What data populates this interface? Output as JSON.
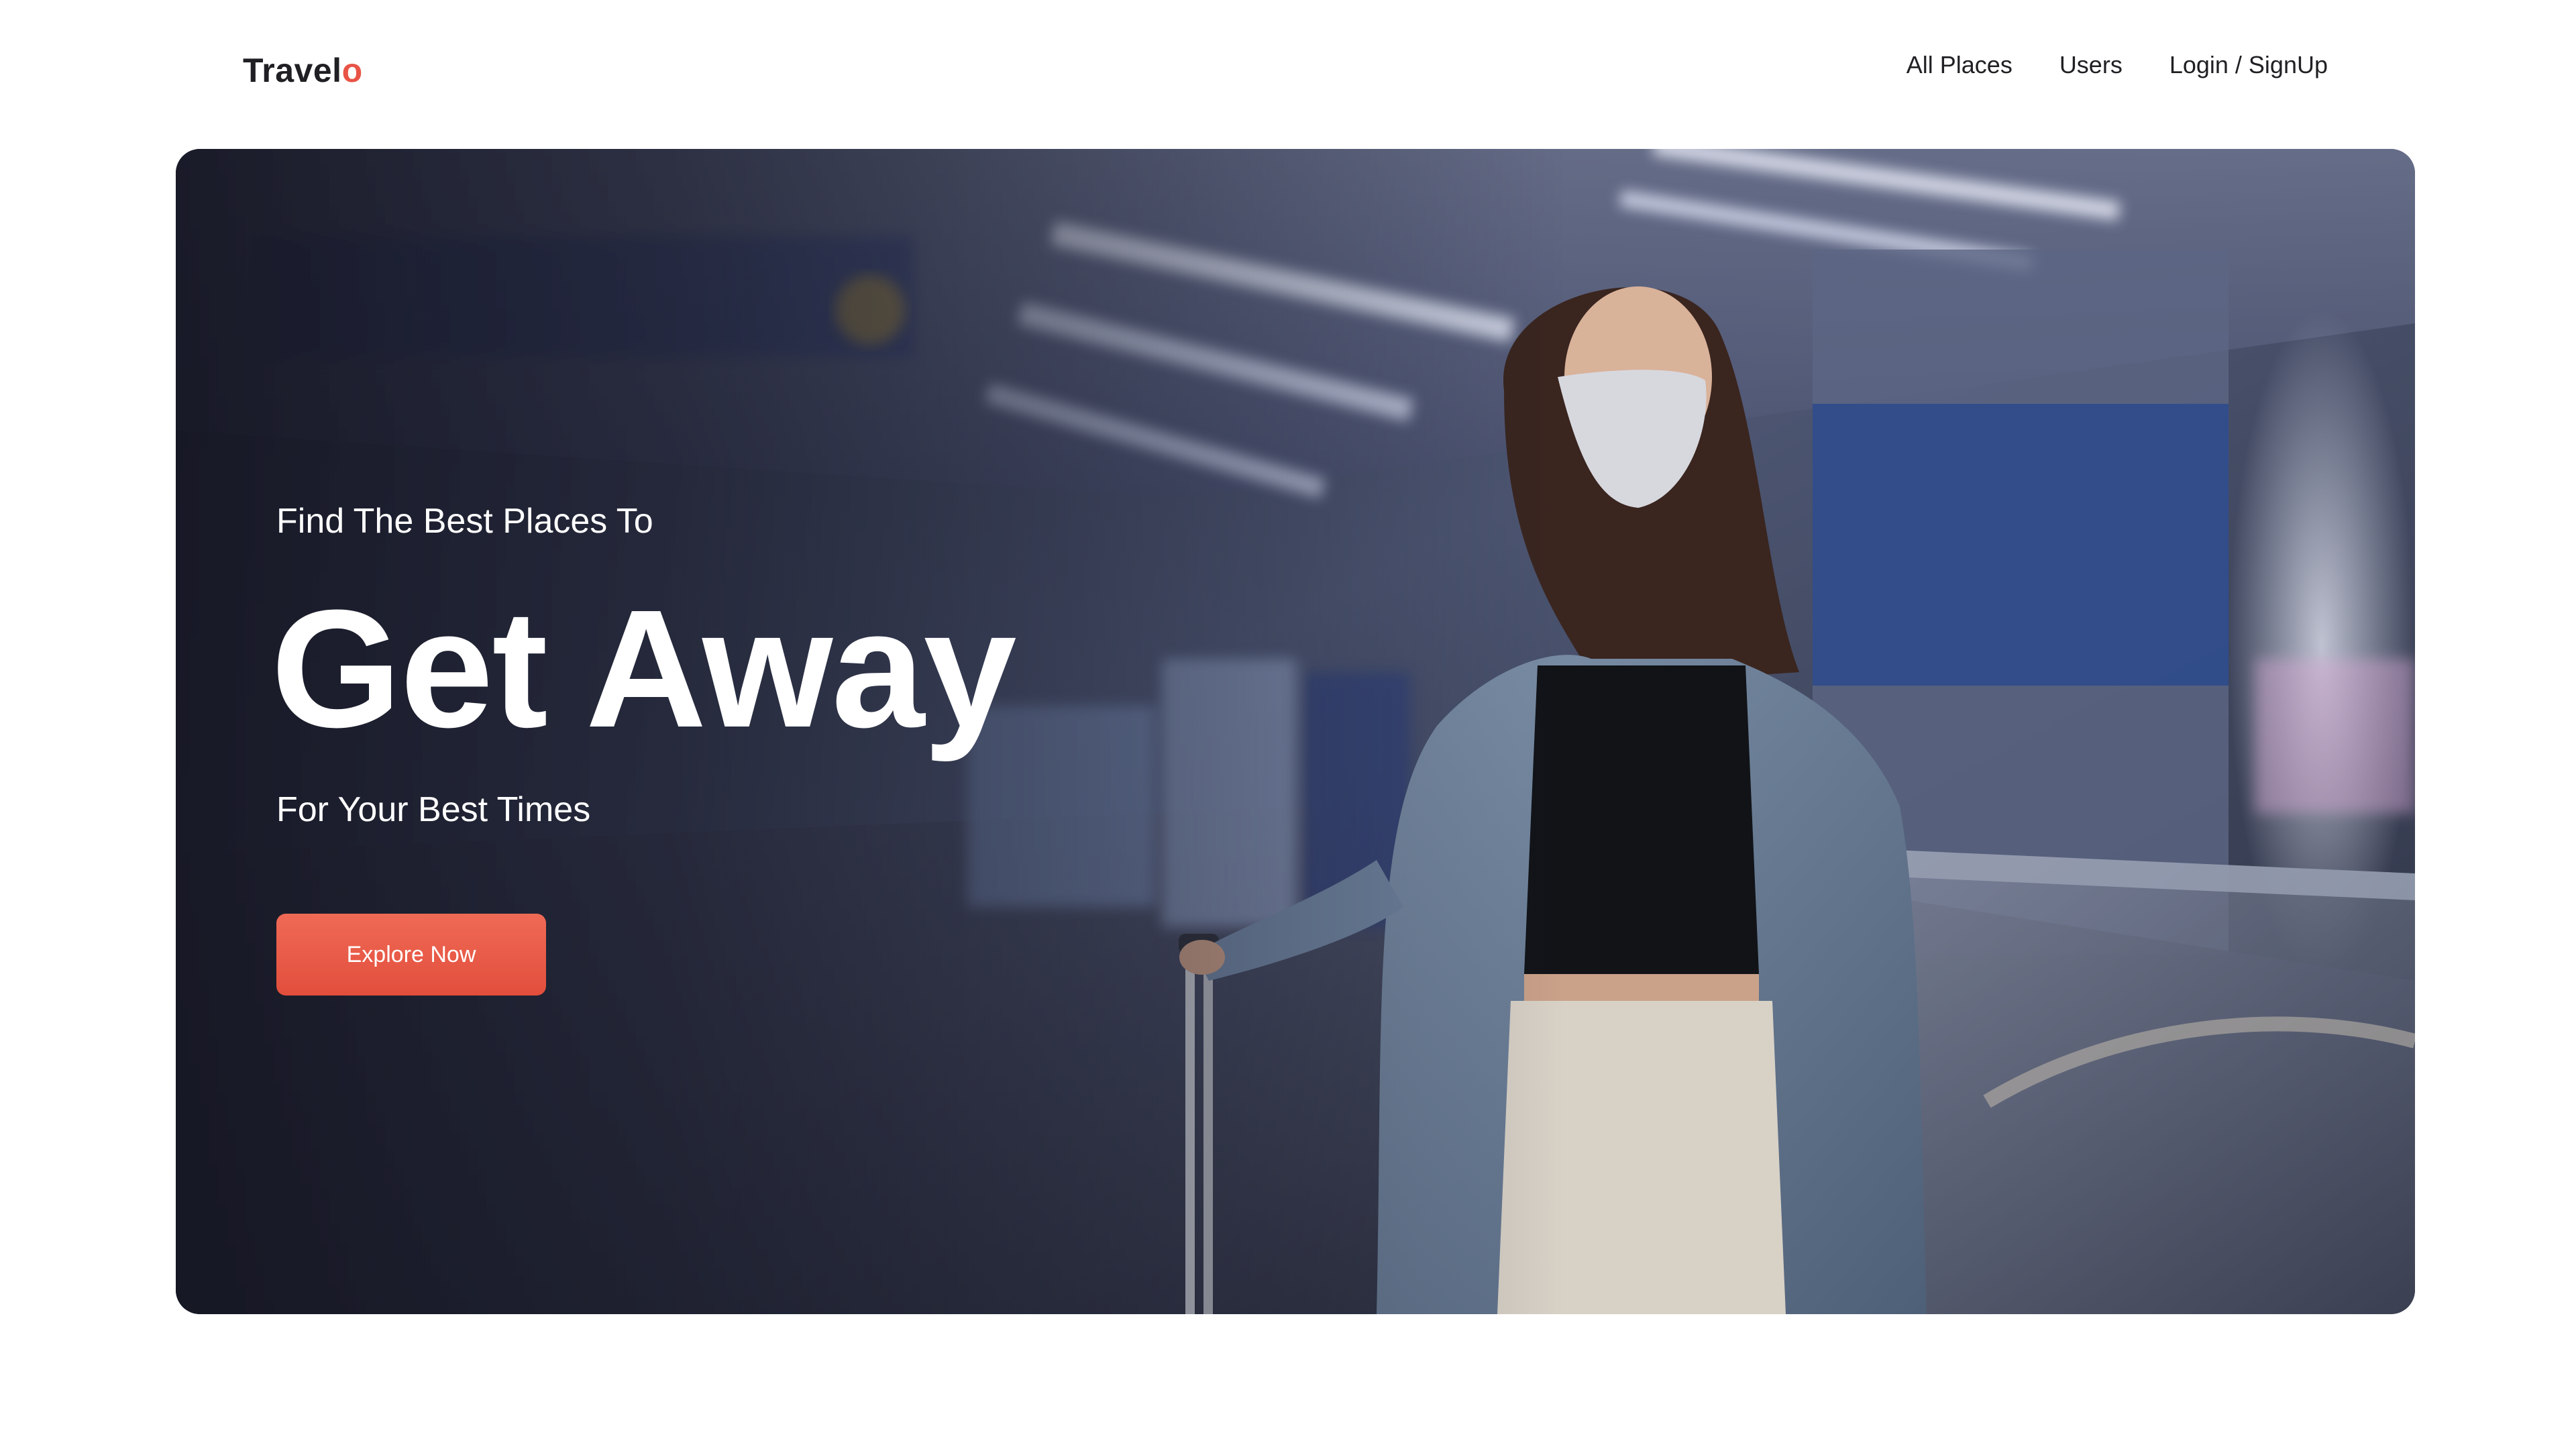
{
  "brand": {
    "name_main": "Travel",
    "name_accent": "o"
  },
  "nav": {
    "links": [
      {
        "label": "All Places"
      },
      {
        "label": "Users"
      },
      {
        "label": "Login / SignUp"
      }
    ]
  },
  "hero": {
    "kicker": "Find The Best Places To",
    "headline": "Get Away",
    "subline": "For Your Best Times",
    "cta_label": "Explore Now",
    "colors": {
      "accent": "#e85446",
      "overlay": "#141522"
    }
  }
}
